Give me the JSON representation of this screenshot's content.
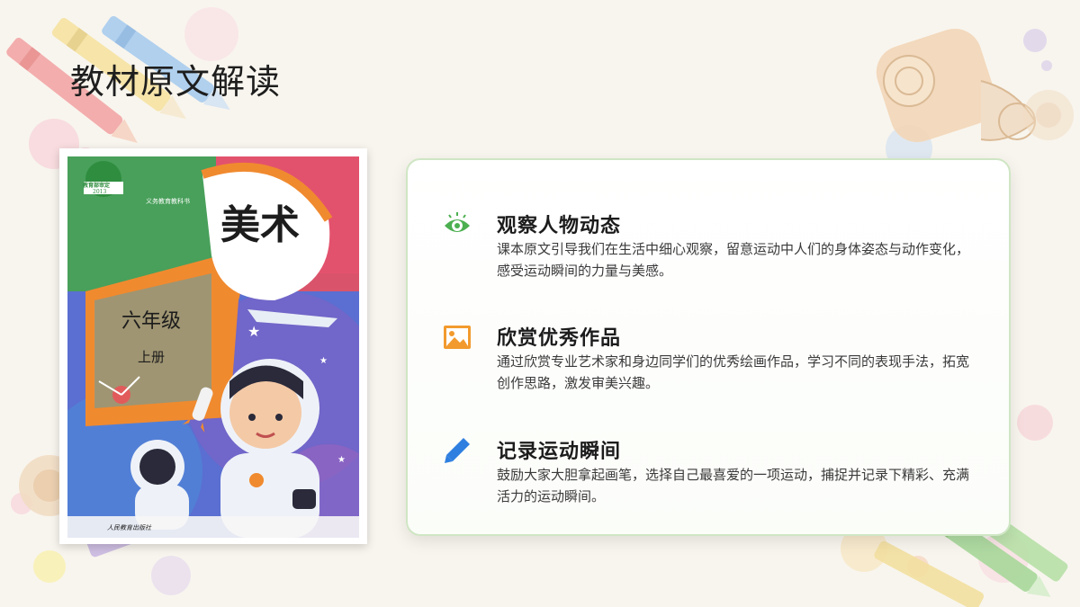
{
  "slide": {
    "title": "教材原文解读"
  },
  "book": {
    "badge_top": "教育部审定",
    "badge_year": "2013",
    "series": "义务教育教科书",
    "subject": "美术",
    "grade": "六年级",
    "volume": "上册",
    "publisher": "人民教育出版社"
  },
  "points": [
    {
      "icon": "eye-icon",
      "title": "观察人物动态",
      "desc": "课本原文引导我们在生活中细心观察，留意运动中人们的身体姿态与动作变化，感受运动瞬间的力量与美感。"
    },
    {
      "icon": "picture-icon",
      "title": "欣赏优秀作品",
      "desc": "通过欣赏专业艺术家和身边同学们的优秀绘画作品，学习不同的表现手法，拓宽创作思路，激发审美兴趣。"
    },
    {
      "icon": "pencil-icon",
      "title": "记录运动瞬间",
      "desc": "鼓励大家大胆拿起画笔，选择自己最喜爱的一项运动，捕捉并记录下精彩、充满活力的运动瞬间。"
    }
  ],
  "colors": {
    "accent_green": "#4caf50",
    "accent_orange": "#f29a2e",
    "accent_blue": "#2f7fe0"
  }
}
